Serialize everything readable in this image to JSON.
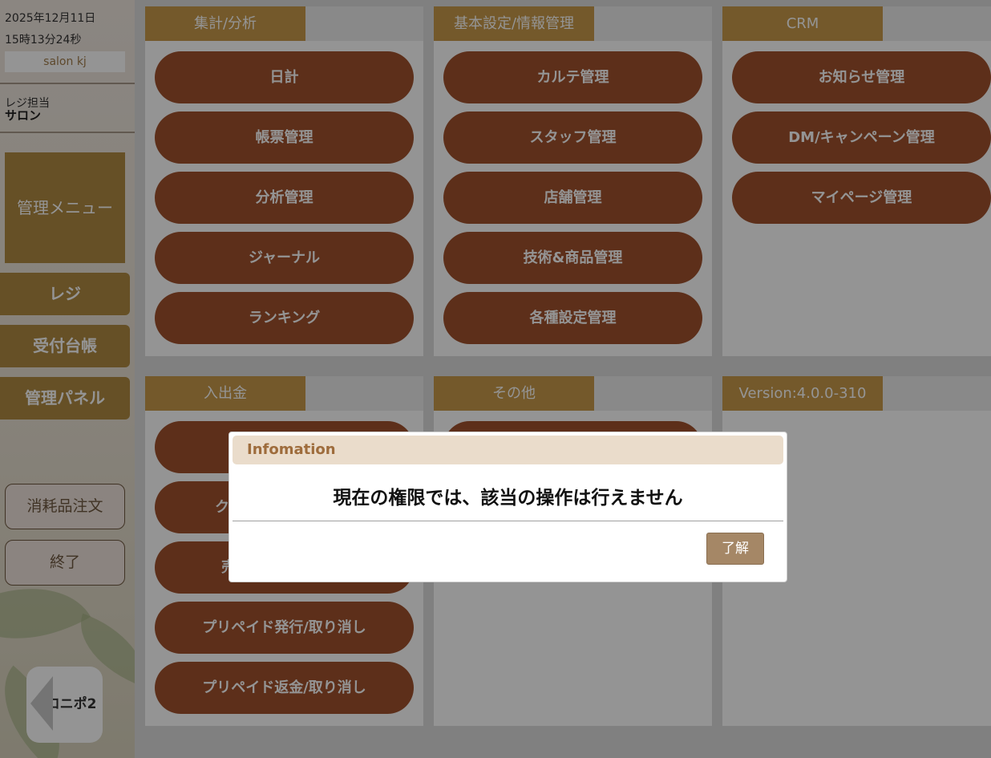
{
  "sidebar": {
    "date": "2025年12月11日",
    "time": "15時13分24秒",
    "salon_name": "salon kj",
    "cashier_label": "レジ担当",
    "cashier_name": "サロン",
    "menu_title": "管理メニュー",
    "nav": [
      "レジ",
      "受付台帳",
      "管理パネル"
    ],
    "order_supplies": "消耗品注文",
    "exit": "終了",
    "logo_text": "サロニポ2"
  },
  "panels": {
    "analytics": {
      "title": "集計/分析",
      "buttons": [
        "日計",
        "帳票管理",
        "分析管理",
        "ジャーナル",
        "ランキング"
      ]
    },
    "settings": {
      "title": "基本設定/情報管理",
      "buttons": [
        "カルテ管理",
        "スタッフ管理",
        "店舗管理",
        "技術&商品管理",
        "各種設定管理"
      ]
    },
    "crm": {
      "title": "CRM",
      "buttons": [
        "お知らせ管理",
        "DM/キャンペーン管理",
        "マイページ管理"
      ]
    },
    "cash": {
      "title": "入出金",
      "buttons": [
        "",
        "ク",
        "売",
        "プリペイド発行/取り消し",
        "プリペイド返金/取り消し"
      ]
    },
    "other": {
      "title": "その他"
    },
    "version": {
      "title": "Version:4.0.0-310"
    }
  },
  "dialog": {
    "title": "Infomation",
    "message": "現在の権限では、該当の操作は行えません",
    "ok": "了解"
  }
}
